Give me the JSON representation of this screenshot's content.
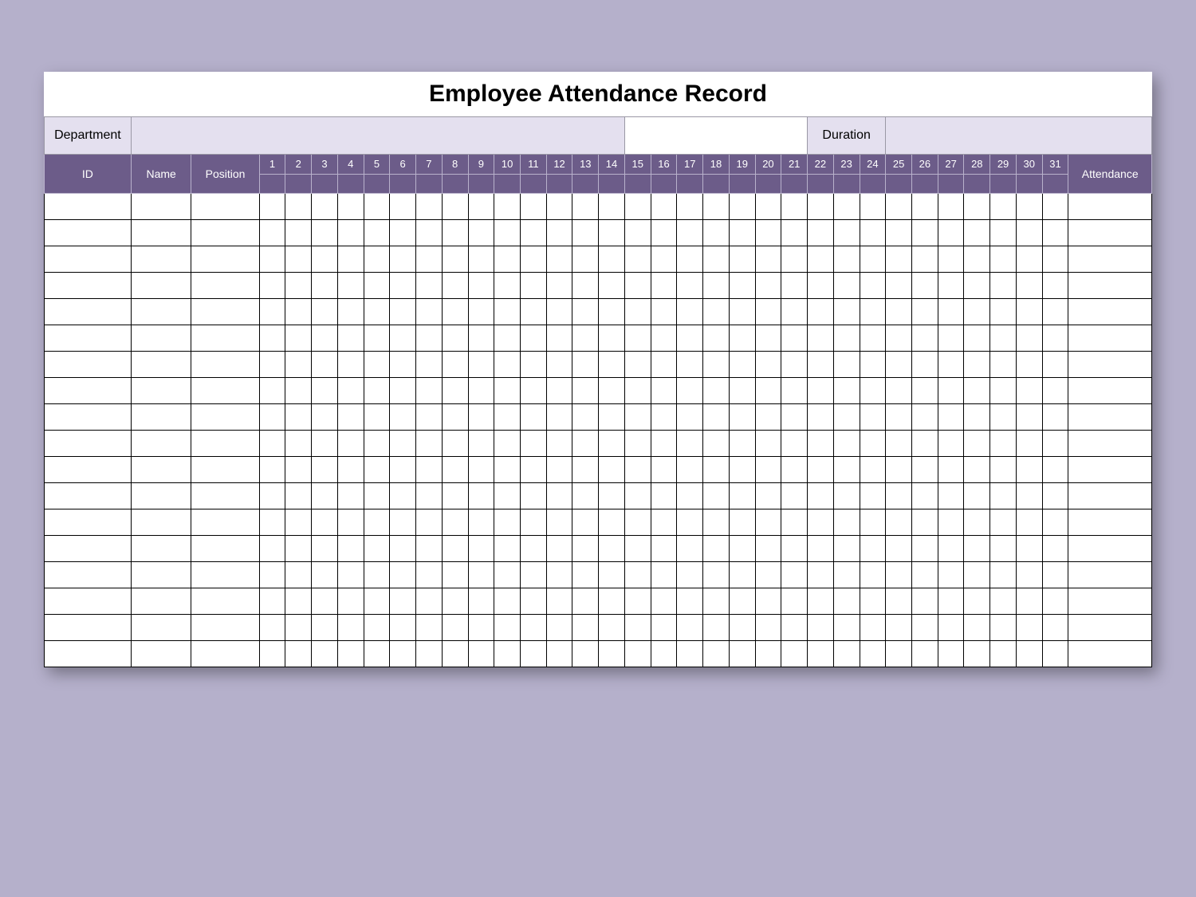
{
  "title": "Employee Attendance Record",
  "meta": {
    "department_label": "Department",
    "department_value": "",
    "duration_label": "Duration",
    "duration_value": ""
  },
  "headers": {
    "id": "ID",
    "name": "Name",
    "position": "Position",
    "attendance": "Attendance",
    "days": [
      "1",
      "2",
      "3",
      "4",
      "5",
      "6",
      "7",
      "8",
      "9",
      "10",
      "11",
      "12",
      "13",
      "14",
      "15",
      "16",
      "17",
      "18",
      "19",
      "20",
      "21",
      "22",
      "23",
      "24",
      "25",
      "26",
      "27",
      "28",
      "29",
      "30",
      "31"
    ]
  },
  "rows": [
    {
      "id": "",
      "name": "",
      "position": "",
      "days": [
        "",
        "",
        "",
        "",
        "",
        "",
        "",
        "",
        "",
        "",
        "",
        "",
        "",
        "",
        "",
        "",
        "",
        "",
        "",
        "",
        "",
        "",
        "",
        "",
        "",
        "",
        "",
        "",
        "",
        "",
        ""
      ],
      "attendance": ""
    },
    {
      "id": "",
      "name": "",
      "position": "",
      "days": [
        "",
        "",
        "",
        "",
        "",
        "",
        "",
        "",
        "",
        "",
        "",
        "",
        "",
        "",
        "",
        "",
        "",
        "",
        "",
        "",
        "",
        "",
        "",
        "",
        "",
        "",
        "",
        "",
        "",
        "",
        ""
      ],
      "attendance": ""
    },
    {
      "id": "",
      "name": "",
      "position": "",
      "days": [
        "",
        "",
        "",
        "",
        "",
        "",
        "",
        "",
        "",
        "",
        "",
        "",
        "",
        "",
        "",
        "",
        "",
        "",
        "",
        "",
        "",
        "",
        "",
        "",
        "",
        "",
        "",
        "",
        "",
        "",
        ""
      ],
      "attendance": ""
    },
    {
      "id": "",
      "name": "",
      "position": "",
      "days": [
        "",
        "",
        "",
        "",
        "",
        "",
        "",
        "",
        "",
        "",
        "",
        "",
        "",
        "",
        "",
        "",
        "",
        "",
        "",
        "",
        "",
        "",
        "",
        "",
        "",
        "",
        "",
        "",
        "",
        "",
        ""
      ],
      "attendance": ""
    },
    {
      "id": "",
      "name": "",
      "position": "",
      "days": [
        "",
        "",
        "",
        "",
        "",
        "",
        "",
        "",
        "",
        "",
        "",
        "",
        "",
        "",
        "",
        "",
        "",
        "",
        "",
        "",
        "",
        "",
        "",
        "",
        "",
        "",
        "",
        "",
        "",
        "",
        ""
      ],
      "attendance": ""
    },
    {
      "id": "",
      "name": "",
      "position": "",
      "days": [
        "",
        "",
        "",
        "",
        "",
        "",
        "",
        "",
        "",
        "",
        "",
        "",
        "",
        "",
        "",
        "",
        "",
        "",
        "",
        "",
        "",
        "",
        "",
        "",
        "",
        "",
        "",
        "",
        "",
        "",
        ""
      ],
      "attendance": ""
    },
    {
      "id": "",
      "name": "",
      "position": "",
      "days": [
        "",
        "",
        "",
        "",
        "",
        "",
        "",
        "",
        "",
        "",
        "",
        "",
        "",
        "",
        "",
        "",
        "",
        "",
        "",
        "",
        "",
        "",
        "",
        "",
        "",
        "",
        "",
        "",
        "",
        "",
        ""
      ],
      "attendance": ""
    },
    {
      "id": "",
      "name": "",
      "position": "",
      "days": [
        "",
        "",
        "",
        "",
        "",
        "",
        "",
        "",
        "",
        "",
        "",
        "",
        "",
        "",
        "",
        "",
        "",
        "",
        "",
        "",
        "",
        "",
        "",
        "",
        "",
        "",
        "",
        "",
        "",
        "",
        ""
      ],
      "attendance": ""
    },
    {
      "id": "",
      "name": "",
      "position": "",
      "days": [
        "",
        "",
        "",
        "",
        "",
        "",
        "",
        "",
        "",
        "",
        "",
        "",
        "",
        "",
        "",
        "",
        "",
        "",
        "",
        "",
        "",
        "",
        "",
        "",
        "",
        "",
        "",
        "",
        "",
        "",
        ""
      ],
      "attendance": ""
    },
    {
      "id": "",
      "name": "",
      "position": "",
      "days": [
        "",
        "",
        "",
        "",
        "",
        "",
        "",
        "",
        "",
        "",
        "",
        "",
        "",
        "",
        "",
        "",
        "",
        "",
        "",
        "",
        "",
        "",
        "",
        "",
        "",
        "",
        "",
        "",
        "",
        "",
        ""
      ],
      "attendance": ""
    },
    {
      "id": "",
      "name": "",
      "position": "",
      "days": [
        "",
        "",
        "",
        "",
        "",
        "",
        "",
        "",
        "",
        "",
        "",
        "",
        "",
        "",
        "",
        "",
        "",
        "",
        "",
        "",
        "",
        "",
        "",
        "",
        "",
        "",
        "",
        "",
        "",
        "",
        ""
      ],
      "attendance": ""
    },
    {
      "id": "",
      "name": "",
      "position": "",
      "days": [
        "",
        "",
        "",
        "",
        "",
        "",
        "",
        "",
        "",
        "",
        "",
        "",
        "",
        "",
        "",
        "",
        "",
        "",
        "",
        "",
        "",
        "",
        "",
        "",
        "",
        "",
        "",
        "",
        "",
        "",
        ""
      ],
      "attendance": ""
    },
    {
      "id": "",
      "name": "",
      "position": "",
      "days": [
        "",
        "",
        "",
        "",
        "",
        "",
        "",
        "",
        "",
        "",
        "",
        "",
        "",
        "",
        "",
        "",
        "",
        "",
        "",
        "",
        "",
        "",
        "",
        "",
        "",
        "",
        "",
        "",
        "",
        "",
        ""
      ],
      "attendance": ""
    },
    {
      "id": "",
      "name": "",
      "position": "",
      "days": [
        "",
        "",
        "",
        "",
        "",
        "",
        "",
        "",
        "",
        "",
        "",
        "",
        "",
        "",
        "",
        "",
        "",
        "",
        "",
        "",
        "",
        "",
        "",
        "",
        "",
        "",
        "",
        "",
        "",
        "",
        ""
      ],
      "attendance": ""
    },
    {
      "id": "",
      "name": "",
      "position": "",
      "days": [
        "",
        "",
        "",
        "",
        "",
        "",
        "",
        "",
        "",
        "",
        "",
        "",
        "",
        "",
        "",
        "",
        "",
        "",
        "",
        "",
        "",
        "",
        "",
        "",
        "",
        "",
        "",
        "",
        "",
        "",
        ""
      ],
      "attendance": ""
    },
    {
      "id": "",
      "name": "",
      "position": "",
      "days": [
        "",
        "",
        "",
        "",
        "",
        "",
        "",
        "",
        "",
        "",
        "",
        "",
        "",
        "",
        "",
        "",
        "",
        "",
        "",
        "",
        "",
        "",
        "",
        "",
        "",
        "",
        "",
        "",
        "",
        "",
        ""
      ],
      "attendance": ""
    },
    {
      "id": "",
      "name": "",
      "position": "",
      "days": [
        "",
        "",
        "",
        "",
        "",
        "",
        "",
        "",
        "",
        "",
        "",
        "",
        "",
        "",
        "",
        "",
        "",
        "",
        "",
        "",
        "",
        "",
        "",
        "",
        "",
        "",
        "",
        "",
        "",
        "",
        ""
      ],
      "attendance": ""
    },
    {
      "id": "",
      "name": "",
      "position": "",
      "days": [
        "",
        "",
        "",
        "",
        "",
        "",
        "",
        "",
        "",
        "",
        "",
        "",
        "",
        "",
        "",
        "",
        "",
        "",
        "",
        "",
        "",
        "",
        "",
        "",
        "",
        "",
        "",
        "",
        "",
        "",
        ""
      ],
      "attendance": ""
    }
  ]
}
